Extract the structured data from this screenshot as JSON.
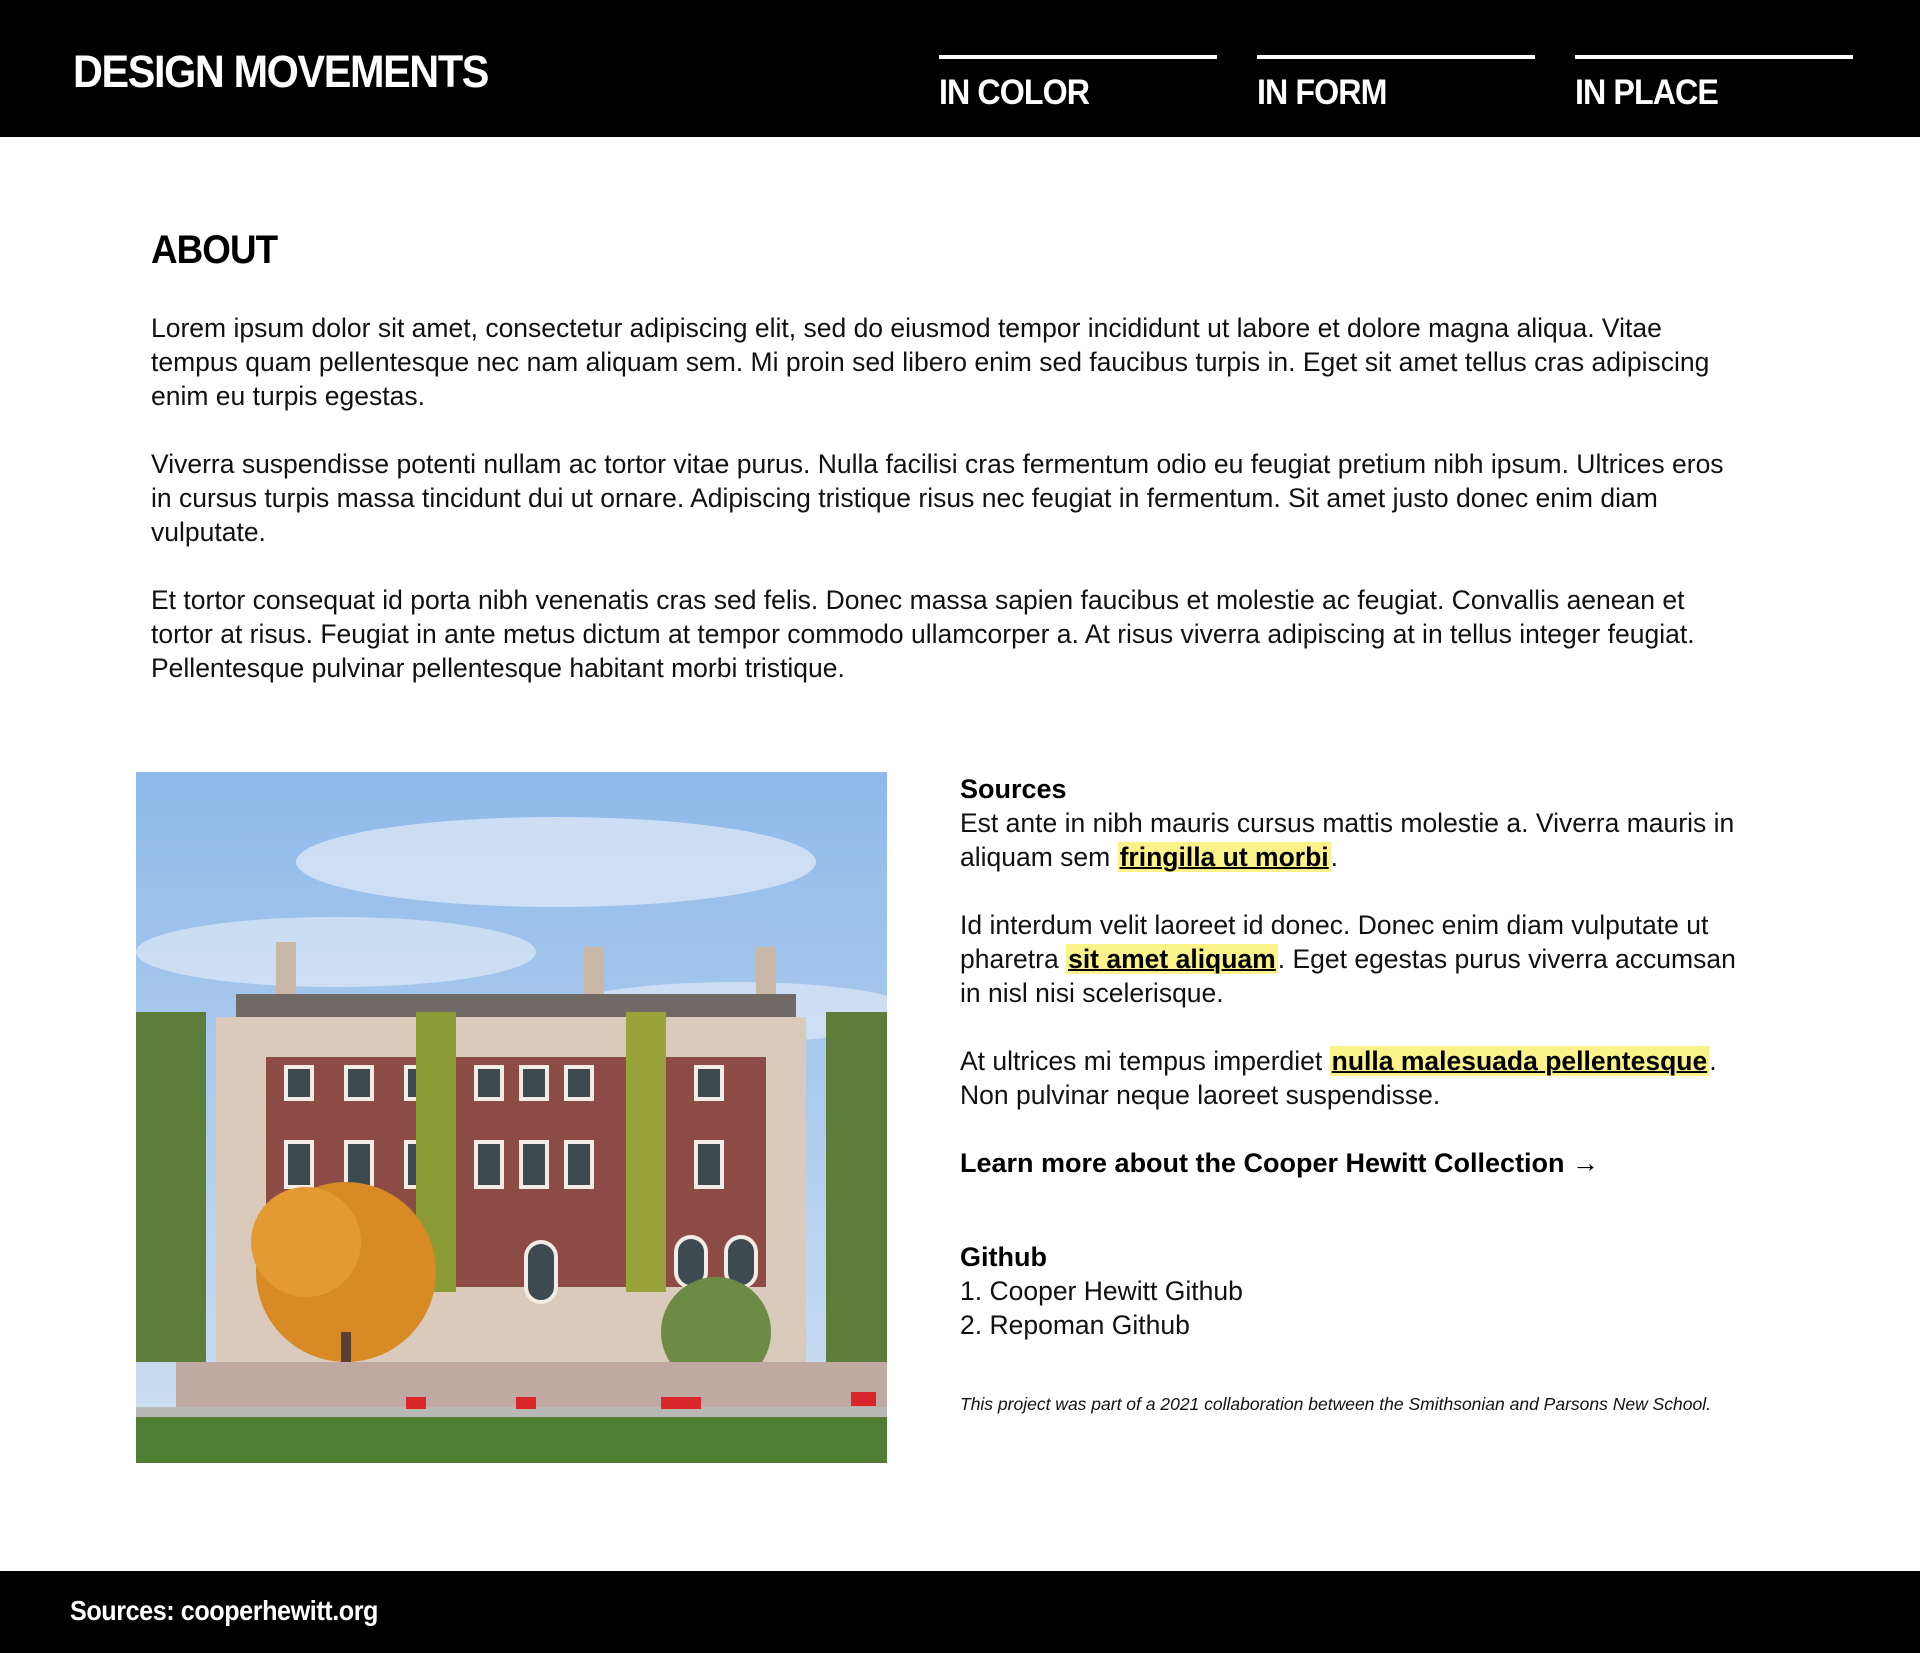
{
  "header": {
    "brand": "DESIGN MOVEMENTS",
    "nav": [
      "IN COLOR",
      "IN FORM",
      "IN PLACE"
    ]
  },
  "about": {
    "title": "ABOUT",
    "paragraphs": [
      "Lorem ipsum dolor sit amet, consectetur adipiscing elit, sed do eiusmod tempor incididunt ut labore et dolore magna aliqua. Vitae tempus quam pellentesque nec nam aliquam sem. Mi proin sed libero enim sed faucibus turpis in. Eget sit amet tellus cras adipiscing enim eu turpis egestas.",
      "Viverra suspendisse potenti nullam ac tortor vitae purus. Nulla facilisi cras fermentum odio eu feugiat pretium nibh ipsum. Ultrices eros in cursus turpis massa tincidunt dui ut ornare. Adipiscing tristique risus nec feugiat in fermentum. Sit amet justo donec enim diam vulputate.",
      "Et tortor consequat id porta nibh venenatis cras sed felis. Donec massa sapien faucibus et molestie ac feugiat. Convallis aenean et tortor at risus. Feugiat in ante metus dictum at tempor commodo ullamcorper a. At risus viverra adipiscing at in tellus integer feugiat. Pellentesque pulvinar pellentesque habitant morbi tristique."
    ]
  },
  "sources": {
    "title": "Sources",
    "p1": {
      "before": "Est ante in nibh mauris cursus mattis molestie a. Viverra mauris in aliquam sem ",
      "link": "fringilla ut morbi",
      "after": "."
    },
    "p2": {
      "before": "Id interdum velit laoreet id donec. Donec enim diam vulputate ut pharetra ",
      "link": "sit amet aliquam",
      "after": ". Eget egestas purus viverra accumsan in nisl nisi scelerisque."
    },
    "p3": {
      "before": "At ultrices mi tempus imperdiet ",
      "link": "nulla malesuada pellentesque",
      "after": ". Non pulvinar neque laoreet suspendisse."
    },
    "learn_more": "Learn more about the Cooper Hewitt Collection →"
  },
  "github": {
    "title": "Github",
    "items": [
      "1. Cooper Hewitt Github",
      "2. Repoman Github"
    ]
  },
  "note": "This project was part of a 2021 collaboration between the Smithsonian and Parsons New School.",
  "footer": {
    "text": "Sources: cooperhewitt.org"
  },
  "colors": {
    "header_bg": "#000000",
    "highlight": "#fbf38a"
  }
}
